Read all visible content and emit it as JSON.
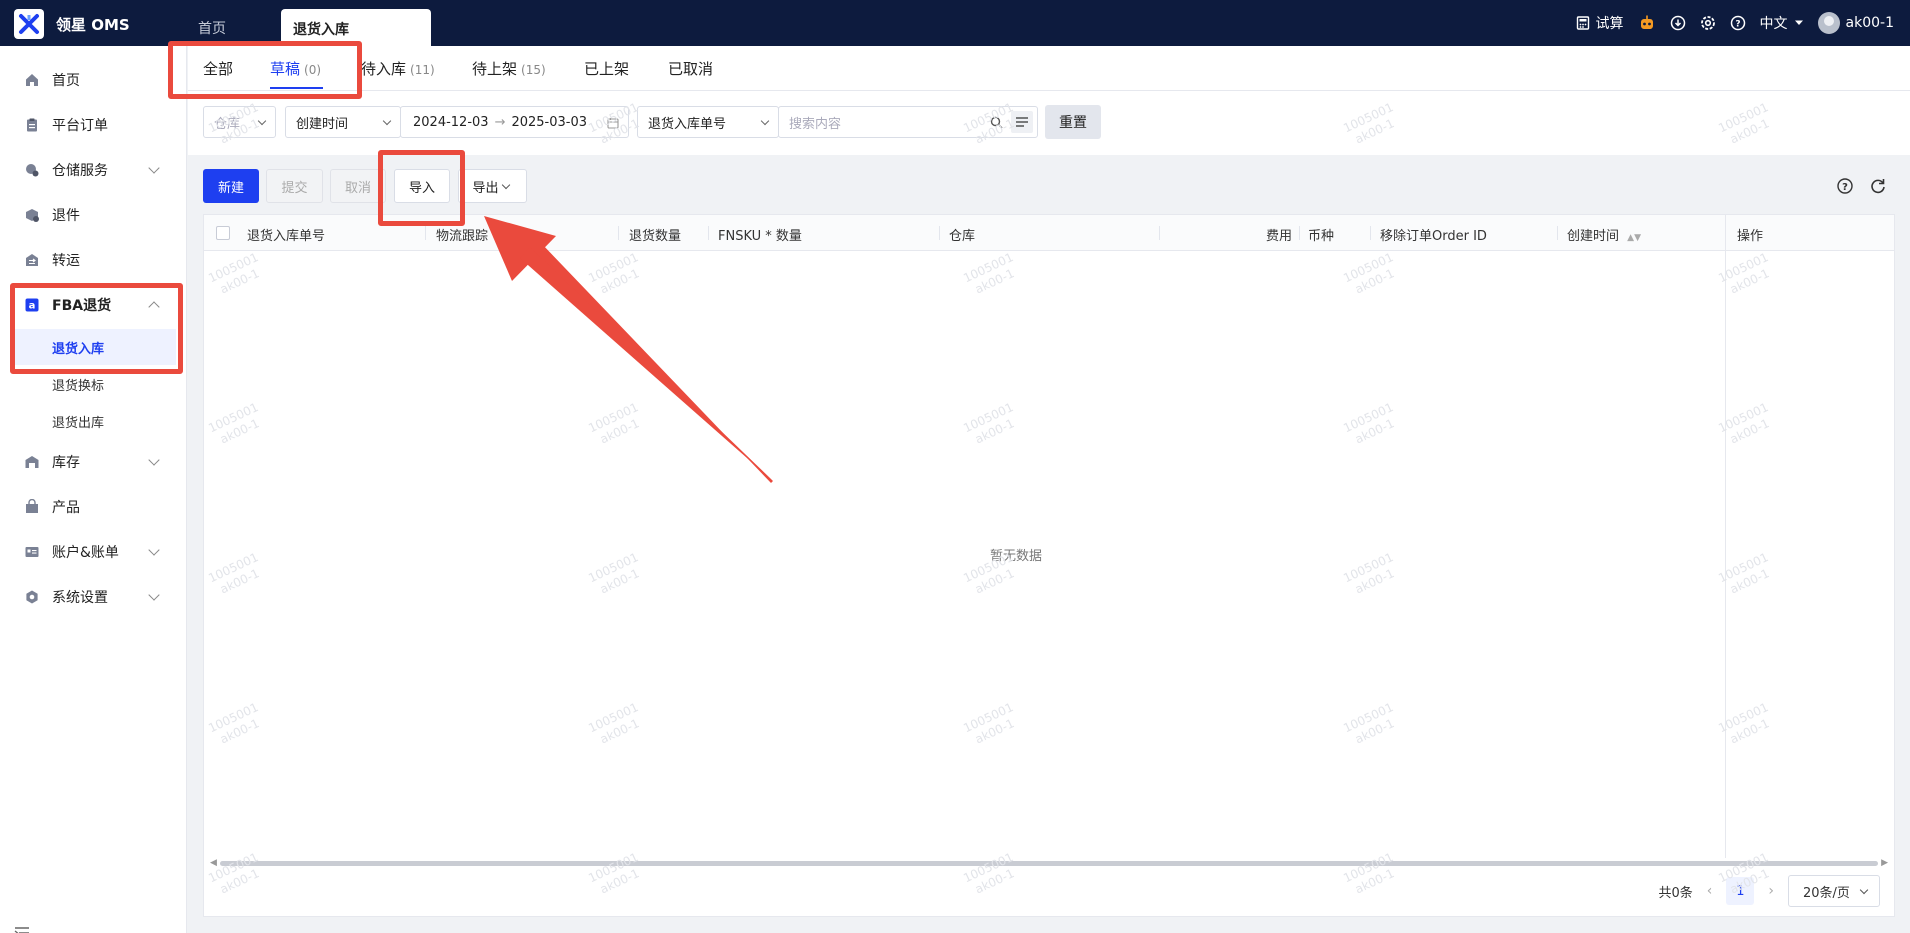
{
  "topbar": {
    "brand": "领星 OMS",
    "tabs": [
      {
        "label": "首页"
      },
      {
        "label": "退货入库"
      }
    ],
    "right": {
      "trial_label": "试算",
      "language": "中文",
      "username": "ak00-1"
    }
  },
  "sidebar": {
    "items": [
      {
        "label": "首页",
        "icon": "home-icon"
      },
      {
        "label": "平台订单",
        "icon": "clipboard-icon"
      },
      {
        "label": "仓储服务",
        "icon": "warehouse-icon"
      },
      {
        "label": "退件",
        "icon": "box-return-icon"
      },
      {
        "label": "转运",
        "icon": "transfer-icon"
      },
      {
        "label": "FBA退货",
        "icon": "amazon-icon"
      },
      {
        "label": "库存",
        "icon": "inventory-icon"
      },
      {
        "label": "产品",
        "icon": "product-icon"
      },
      {
        "label": "账户&账单",
        "icon": "account-icon"
      },
      {
        "label": "系统设置",
        "icon": "settings-icon"
      }
    ],
    "fba_sub": [
      {
        "label": "退货入库"
      },
      {
        "label": "退货换标"
      },
      {
        "label": "退货出库"
      }
    ]
  },
  "status_tabs": [
    {
      "label": "全部",
      "count": ""
    },
    {
      "label": "草稿",
      "count": "(0)"
    },
    {
      "label": "待入库",
      "count": "(11)"
    },
    {
      "label": "待上架",
      "count": "(15)"
    },
    {
      "label": "已上架",
      "count": ""
    },
    {
      "label": "已取消",
      "count": ""
    }
  ],
  "filters": {
    "warehouse_placeholder": "仓库",
    "time_type": "创建时间",
    "date_start": "2024-12-03",
    "date_end": "2025-03-03",
    "search_field": "退货入库单号",
    "search_placeholder": "搜索内容",
    "reset_label": "重置"
  },
  "toolbar": {
    "new_label": "新建",
    "submit_label": "提交",
    "cancel_label": "取消",
    "import_label": "导入",
    "export_label": "导出"
  },
  "table": {
    "columns": [
      "退货入库单号",
      "物流跟踪",
      "退货数量",
      "FNSKU * 数量",
      "仓库",
      "费用",
      "币种",
      "移除订单Order ID",
      "创建时间",
      "操作"
    ],
    "empty_text": "暂无数据"
  },
  "pagination": {
    "total_text": "共0条",
    "current_page": "1",
    "page_size": "20条/页"
  },
  "watermark": {
    "line1": "1005001",
    "line2": "ak00-1"
  },
  "colors": {
    "primary": "#1e3ff0",
    "topbar": "#0d1b3e",
    "annotation": "#ea4a3d"
  }
}
